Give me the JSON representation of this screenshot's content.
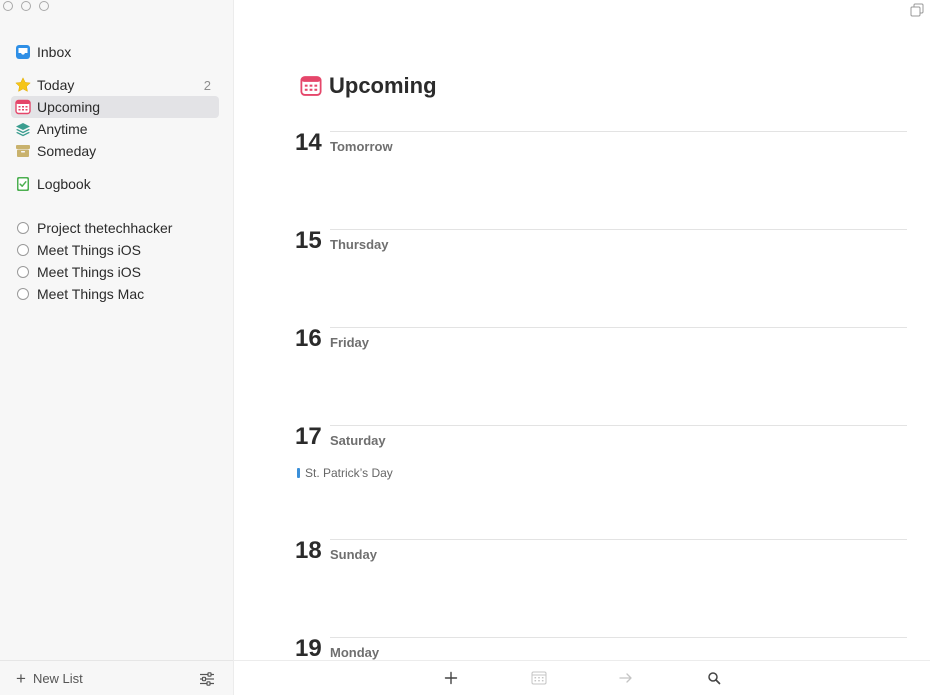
{
  "sidebar": {
    "inbox": {
      "label": "Inbox",
      "icon": "inbox-icon"
    },
    "today": {
      "label": "Today",
      "count": "2",
      "icon": "star-icon"
    },
    "upcoming": {
      "label": "Upcoming",
      "icon": "calendar-icon",
      "selected": true
    },
    "anytime": {
      "label": "Anytime",
      "icon": "layers-icon"
    },
    "someday": {
      "label": "Someday",
      "icon": "archive-box-icon"
    },
    "logbook": {
      "label": "Logbook",
      "icon": "logbook-check-icon"
    },
    "projects": [
      {
        "label": "Project thetechhacker"
      },
      {
        "label": "Meet Things iOS"
      },
      {
        "label": "Meet Things iOS"
      },
      {
        "label": "Meet Things Mac"
      }
    ],
    "footer": {
      "new_list_label": "New List"
    }
  },
  "main": {
    "title": "Upcoming",
    "days": [
      {
        "number": "14",
        "name": "Tomorrow"
      },
      {
        "number": "15",
        "name": "Thursday"
      },
      {
        "number": "16",
        "name": "Friday"
      },
      {
        "number": "17",
        "name": "Saturday",
        "events": [
          {
            "label": "St. Patrick’s Day"
          }
        ]
      },
      {
        "number": "18",
        "name": "Sunday"
      },
      {
        "number": "19",
        "name": "Monday"
      }
    ],
    "toolbar": {
      "buttons": [
        "plus-icon",
        "calendar-icon",
        "arrow-right-icon",
        "search-icon"
      ]
    }
  },
  "colors": {
    "sidebar_bg": "#f7f7f7",
    "selected_bg": "#e3e3e6",
    "inbox_blue": "#2f8fe6",
    "today_yellow": "#f5c518",
    "upcoming_red": "#e5466a",
    "anytime_teal": "#3a9d8f",
    "someday_tan": "#c9b26d",
    "logbook_green": "#4caf50",
    "event_blue": "#3a8fd9"
  }
}
